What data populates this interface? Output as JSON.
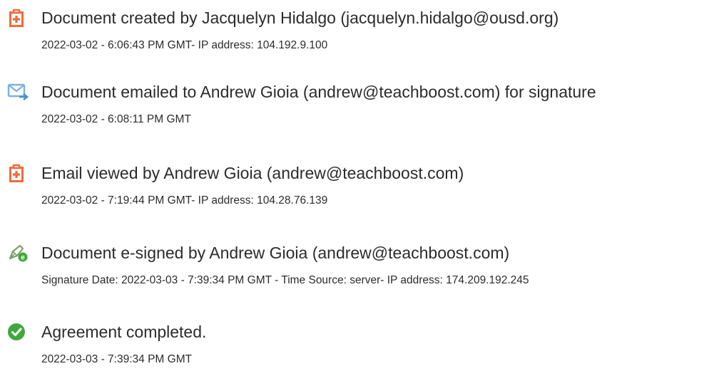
{
  "events": [
    {
      "icon": "document-add-icon",
      "title": "Document created by Jacquelyn Hidalgo (jacquelyn.hidalgo@ousd.org)",
      "detail": "2022-03-02 - 6:06:43 PM GMT- IP address: 104.192.9.100"
    },
    {
      "icon": "email-send-icon",
      "title": "Document emailed to Andrew Gioia (andrew@teachboost.com) for signature",
      "detail": "2022-03-02 - 6:08:11 PM GMT"
    },
    {
      "icon": "document-add-icon",
      "title": "Email viewed by Andrew Gioia (andrew@teachboost.com)",
      "detail": "2022-03-02 - 7:19:44 PM GMT- IP address: 104.28.76.139"
    },
    {
      "icon": "e-sign-pen-icon",
      "title": "Document e-signed by Andrew Gioia (andrew@teachboost.com)",
      "detail": "Signature Date: 2022-03-03 - 7:39:34 PM GMT - Time Source: server- IP address: 174.209.192.245"
    },
    {
      "icon": "check-circle-icon",
      "title": "Agreement completed.",
      "detail": "2022-03-03 - 7:39:34 PM GMT"
    }
  ],
  "colors": {
    "document_icon": "#ef6b3a",
    "email_icon": "#7bb1e0",
    "sign_icon": "#7a9e6a",
    "check_icon": "#40a83d",
    "text": "#2c2c2c"
  }
}
